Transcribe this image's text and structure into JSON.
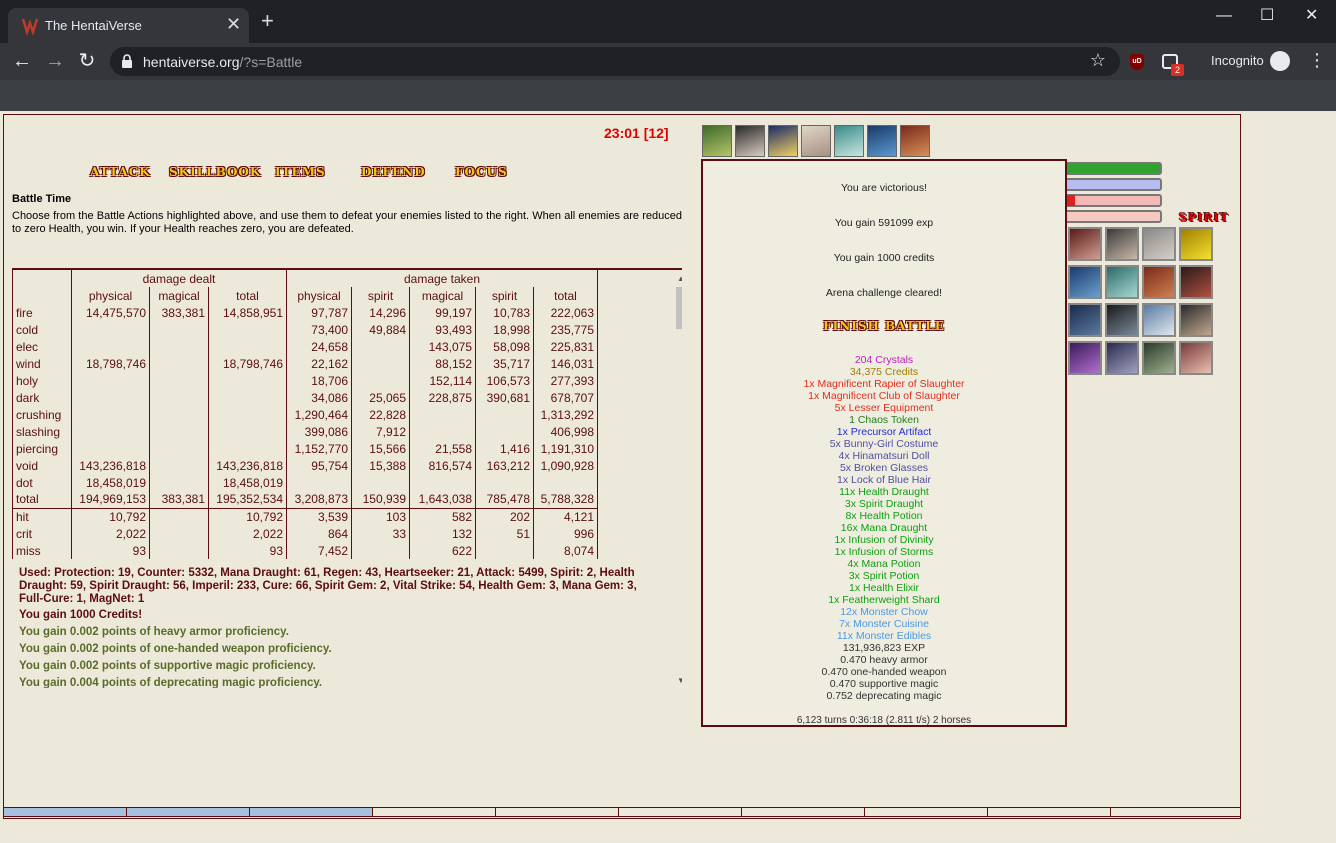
{
  "browser": {
    "tab_title": "The HentaiVerse",
    "tab_close": "✕",
    "new_tab": "+",
    "url_host": "hentaiverse.org",
    "url_path": "/?s=Battle",
    "incognito_label": "Incognito",
    "ext_badge": "2",
    "ublock_label": "uD"
  },
  "battle": {
    "timer": "23:01 [12]",
    "actions": [
      "ATTACK",
      "SKILLBOOK",
      "ITEMS",
      "DEFEND",
      "FOCUS"
    ],
    "intro_title": "Battle Time",
    "intro_text": "Choose from the Battle Actions highlighted above, and use them to defeat your enemies listed to the right. When all enemies are reduced to zero Health, you win. If your Health reaches zero, you are defeated."
  },
  "stats": {
    "group_dealt": "damage dealt",
    "group_taken": "damage taken",
    "headers": [
      "",
      "physical",
      "magical",
      "total",
      "physical",
      "spirit",
      "magical",
      "spirit",
      "total"
    ],
    "rows": [
      [
        "fire",
        "14,475,570",
        "383,381",
        "14,858,951",
        "97,787",
        "14,296",
        "99,197",
        "10,783",
        "222,063"
      ],
      [
        "cold",
        "",
        "",
        "",
        "73,400",
        "49,884",
        "93,493",
        "18,998",
        "235,775"
      ],
      [
        "elec",
        "",
        "",
        "",
        "24,658",
        "",
        "143,075",
        "58,098",
        "225,831"
      ],
      [
        "wind",
        "18,798,746",
        "",
        "18,798,746",
        "22,162",
        "",
        "88,152",
        "35,717",
        "146,031"
      ],
      [
        "holy",
        "",
        "",
        "",
        "18,706",
        "",
        "152,114",
        "106,573",
        "277,393"
      ],
      [
        "dark",
        "",
        "",
        "",
        "34,086",
        "25,065",
        "228,875",
        "390,681",
        "678,707"
      ],
      [
        "crushing",
        "",
        "",
        "",
        "1,290,464",
        "22,828",
        "",
        "",
        "1,313,292"
      ],
      [
        "slashing",
        "",
        "",
        "",
        "399,086",
        "7,912",
        "",
        "",
        "406,998"
      ],
      [
        "piercing",
        "",
        "",
        "",
        "1,152,770",
        "15,566",
        "21,558",
        "1,416",
        "1,191,310"
      ],
      [
        "void",
        "143,236,818",
        "",
        "143,236,818",
        "95,754",
        "15,388",
        "816,574",
        "163,212",
        "1,090,928"
      ],
      [
        "dot",
        "18,458,019",
        "",
        "18,458,019",
        "",
        "",
        "",
        "",
        ""
      ],
      [
        "total",
        "194,969,153",
        "383,381",
        "195,352,534",
        "3,208,873",
        "150,939",
        "1,643,038",
        "785,478",
        "5,788,328"
      ]
    ],
    "hit_rows": [
      [
        "hit",
        "10,792",
        "",
        "10,792",
        "3,539",
        "103",
        "582",
        "202",
        "4,121"
      ],
      [
        "crit",
        "2,022",
        "",
        "2,022",
        "864",
        "33",
        "132",
        "51",
        "996"
      ],
      [
        "miss",
        "93",
        "",
        "93",
        "7,452",
        "",
        "622",
        "",
        "8,074"
      ]
    ]
  },
  "log": {
    "used": "Used: Protection: 19, Counter: 5332, Mana Draught: 61, Regen: 43, Heartseeker: 21, Attack: 5499, Spirit: 2, Health Draught: 59, Spirit Draught: 56, Imperil: 233, Cure: 66, Spirit Gem: 2, Vital Strike: 54, Health Gem: 3, Mana Gem: 3, Full-Cure: 1, MagNet: 1",
    "lines": [
      {
        "text": "You gain 1000 Credits!",
        "color": "#5c0d11"
      },
      {
        "text": "You gain 0.002 points of heavy armor proficiency.",
        "color": "#5a6b2a"
      },
      {
        "text": "You gain 0.002 points of one-handed weapon proficiency.",
        "color": "#5a6b2a"
      },
      {
        "text": "You gain 0.002 points of supportive magic proficiency.",
        "color": "#5a6b2a"
      },
      {
        "text": "You gain 0.004 points of deprecating magic proficiency.",
        "color": "#5a6b2a"
      }
    ]
  },
  "victory": {
    "messages": [
      "You are victorious!",
      "You gain 591099 exp",
      "You gain 1000 credits",
      "Arena challenge cleared!"
    ],
    "finish_label": "FINISH BATTLE",
    "drops": [
      {
        "text": "204 Crystals",
        "color": "#c020c0"
      },
      {
        "text": "34,375 Credits",
        "color": "#a08000"
      },
      {
        "text": "1x Magnificent Rapier of Slaughter",
        "color": "#e03020"
      },
      {
        "text": "1x Magnificent Club of Slaughter",
        "color": "#e03020"
      },
      {
        "text": "5x Lesser Equipment",
        "color": "#e03020"
      },
      {
        "text": "1 Chaos Token",
        "color": "#208020"
      },
      {
        "text": "1x Precursor Artifact",
        "color": "#2030d0"
      },
      {
        "text": "5x Bunny-Girl Costume",
        "color": "#5050a0"
      },
      {
        "text": "4x Hinamatsuri Doll",
        "color": "#5050a0"
      },
      {
        "text": "5x Broken Glasses",
        "color": "#5050a0"
      },
      {
        "text": "1x Lock of Blue Hair",
        "color": "#5050a0"
      },
      {
        "text": "11x Health Draught",
        "color": "#10a010"
      },
      {
        "text": "3x Spirit Draught",
        "color": "#10a010"
      },
      {
        "text": "8x Health Potion",
        "color": "#10a010"
      },
      {
        "text": "16x Mana Draught",
        "color": "#10a010"
      },
      {
        "text": "1x Infusion of Divinity",
        "color": "#10a010"
      },
      {
        "text": "1x Infusion of Storms",
        "color": "#10a010"
      },
      {
        "text": "4x Mana Potion",
        "color": "#10a010"
      },
      {
        "text": "3x Spirit Potion",
        "color": "#10a010"
      },
      {
        "text": "1x Health Elixir",
        "color": "#10a010"
      },
      {
        "text": "1x Featherweight Shard",
        "color": "#10a010"
      },
      {
        "text": "12x Monster Chow",
        "color": "#4a9ae0"
      },
      {
        "text": "7x Monster Cuisine",
        "color": "#4a9ae0"
      },
      {
        "text": "11x Monster Edibles",
        "color": "#4a9ae0"
      },
      {
        "text": "131,936,823 EXP",
        "color": "#333333"
      },
      {
        "text": "0.470 heavy armor",
        "color": "#333333"
      },
      {
        "text": "0.470 one-handed weapon",
        "color": "#333333"
      },
      {
        "text": "0.470 supportive magic",
        "color": "#333333"
      },
      {
        "text": "0.752 deprecating magic",
        "color": "#333333"
      }
    ],
    "summary": "6,123 turns 0:36:18 (2.811 t/s) 2 horses"
  },
  "player": {
    "spirit_label": "SPIRIT",
    "bar_colors": [
      "#2ea32e",
      "#b8bdf0",
      "#f5b8b8",
      "#f5c8c0"
    ]
  }
}
